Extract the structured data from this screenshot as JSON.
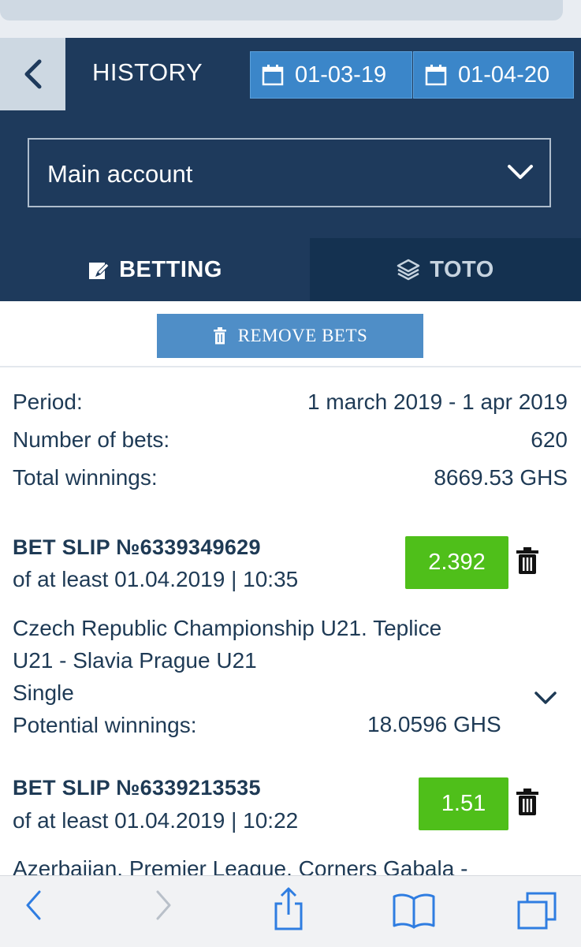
{
  "header": {
    "title": "HISTORY",
    "date_from": "01-03-19",
    "date_to": "01-04-20"
  },
  "account": {
    "selected": "Main account"
  },
  "tabs": [
    {
      "label": "BETTING",
      "active": true
    },
    {
      "label": "TOTO",
      "active": false
    }
  ],
  "remove_label": "REMOVE BETS",
  "summary": {
    "period_label": "Period:",
    "period_value": "1 march 2019 - 1 apr 2019",
    "bets_label": "Number of bets:",
    "bets_value": "620",
    "winnings_label": "Total winnings:",
    "winnings_value": "8669.53 GHS"
  },
  "slips": [
    {
      "title": "BET SLIP №6339349629",
      "date": "of at least 01.04.2019 | 10:35",
      "odds": "2.392",
      "event_line1": "Czech Republic Championship U21. Teplice",
      "event_line2": "U21 - Slavia Prague U21",
      "type": "Single",
      "potential_label": "Potential winnings:",
      "potential_value": "18.0596 GHS"
    },
    {
      "title": "BET SLIP №6339213535",
      "date": "of at least 01.04.2019 | 10:22",
      "odds": "1.51",
      "event_line1": "Azerbaijan. Premier League. Corners Gabala -"
    }
  ],
  "colors": {
    "header_bg": "#1e3a5c",
    "accent_blue": "#3b86c9",
    "odds_green": "#4fbf1a",
    "text_dark": "#1e3a55"
  }
}
